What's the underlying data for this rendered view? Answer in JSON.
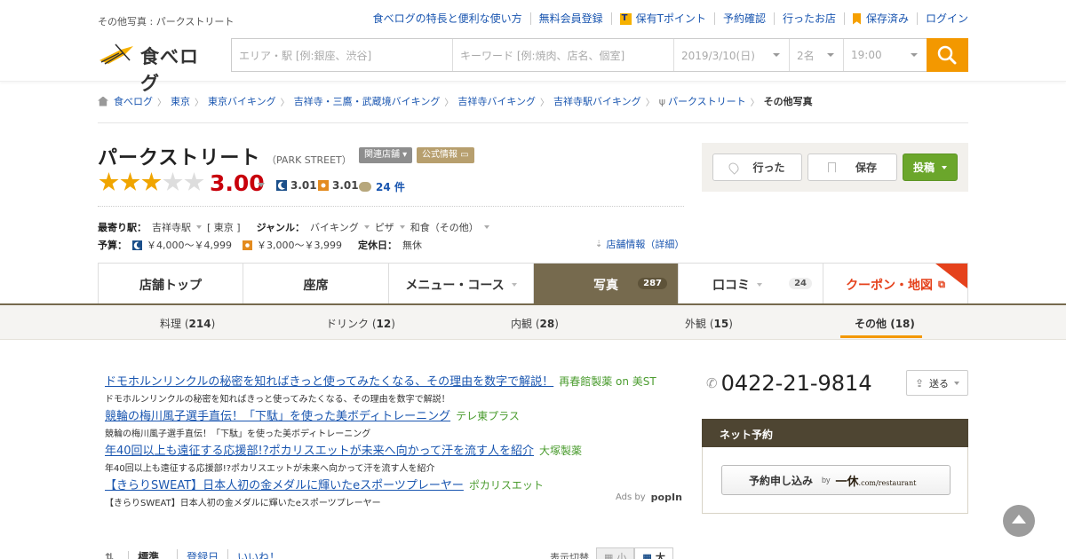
{
  "header": {
    "tagline": "その他写真 : パークストリート",
    "links": [
      {
        "label": "食べログの特長と便利な使い方",
        "icon": ""
      },
      {
        "label": "無料会員登録",
        "icon": ""
      },
      {
        "label": "保有Tポイント",
        "icon": "tpoint-icon"
      },
      {
        "label": "予約確認",
        "icon": ""
      },
      {
        "label": "行ったお店",
        "icon": ""
      },
      {
        "label": "保存済み",
        "icon": "bookmark-icon"
      },
      {
        "label": "ログイン",
        "icon": ""
      }
    ],
    "logo_text": "食べログ"
  },
  "search": {
    "area_placeholder": "エリア・駅 [例:銀座、渋谷]",
    "keyword_placeholder": "キーワード [例:焼肉、店名、個室]",
    "date": "2019/3/10(日)",
    "people": "2名",
    "time": "19:00"
  },
  "breadcrumb": [
    "食べログ",
    "東京",
    "東京バイキング",
    "吉祥寺・三鷹・武蔵境バイキング",
    "吉祥寺バイキング",
    "吉祥寺駅バイキング",
    "パークストリート",
    "その他写真"
  ],
  "restaurant": {
    "name": "パークストリート",
    "name_en": "（PARK STREET）",
    "tag_related": "関連店舗",
    "tag_official": "公式情報",
    "rating": 3.0,
    "score": "3.00",
    "dinner_score": "3.01",
    "lunch_score": "3.01",
    "reviews": "24 件",
    "station_label": "最寄り駅：",
    "station": "吉祥寺駅",
    "station_area": "[ 東京 ]",
    "genre_label": "ジャンル：",
    "genres": [
      "バイキング",
      "ピザ",
      "和食（その他）"
    ],
    "budget_label": "予算：",
    "budget_dinner": "￥4,000～￥4,999",
    "budget_lunch": "￥3,000～￥3,999",
    "holiday_label": "定休日：",
    "holiday": "無休",
    "detail_link": "店舗情報（詳細）"
  },
  "actions": {
    "went": "行った",
    "save": "保存",
    "post": "投稿"
  },
  "tabs": [
    {
      "label": "店舗トップ",
      "count": ""
    },
    {
      "label": "座席",
      "count": ""
    },
    {
      "label": "メニュー・コース",
      "count": ""
    },
    {
      "label": "写真",
      "count": "287"
    },
    {
      "label": "口コミ",
      "count": "24"
    },
    {
      "label": "クーポン・地図",
      "count": ""
    }
  ],
  "subtabs": [
    {
      "label": "料理",
      "count": "214"
    },
    {
      "label": "ドリンク",
      "count": "12"
    },
    {
      "label": "内観",
      "count": "28"
    },
    {
      "label": "外観",
      "count": "15"
    },
    {
      "label": "その他",
      "count": "18"
    }
  ],
  "ads": [
    {
      "title": "ドモホルンリンクルの秘密を知ればきっと使ってみたくなる、その理由を数字で解説！",
      "source": "再春館製薬 on 美ST",
      "desc": "ドモホルンリンクルの秘密を知ればきっと使ってみたくなる、その理由を数字で解説！"
    },
    {
      "title": "競輪の梅川風子選手直伝！「下駄」を使った美ボディトレーニング",
      "source": "テレ東プラス",
      "desc": "競輪の梅川風子選手直伝！「下駄」を使った美ボディトレーニング"
    },
    {
      "title": "年40回以上も遠征する応援部!?ポカリスエットが未来へ向かって汗を流す人を紹介",
      "source": "大塚製薬",
      "desc": "年40回以上も遠征する応援部!?ポカリスエットが未来へ向かって汗を流す人を紹介"
    },
    {
      "title": "【きらりSWEAT】日本人初の金メダルに輝いたeスポーツプレーヤー",
      "source": "ポカリスエット",
      "desc": "【きらりSWEAT】日本人初の金メダルに輝いたeスポーツプレーヤー"
    }
  ],
  "ads_by": "Ads by",
  "ads_brand": "popIn",
  "sidebar": {
    "phone": "0422-21-9814",
    "send": "送る",
    "net_reserve": "ネット予約",
    "reserve_btn": "予約申し込み",
    "reserve_by": "by",
    "ikyu_main": "一休",
    "ikyu_sub": ".com/restaurant"
  },
  "toolbar": {
    "sort": [
      "標準",
      "登録日",
      "いいね！"
    ],
    "view_switch": "表示切替",
    "small": "小",
    "large": "大"
  },
  "colors": {
    "accent": "#f39800",
    "brown": "#766a4e",
    "score_red": "#c8000b",
    "link": "#1a56b0",
    "post_green": "#6ba62b"
  }
}
